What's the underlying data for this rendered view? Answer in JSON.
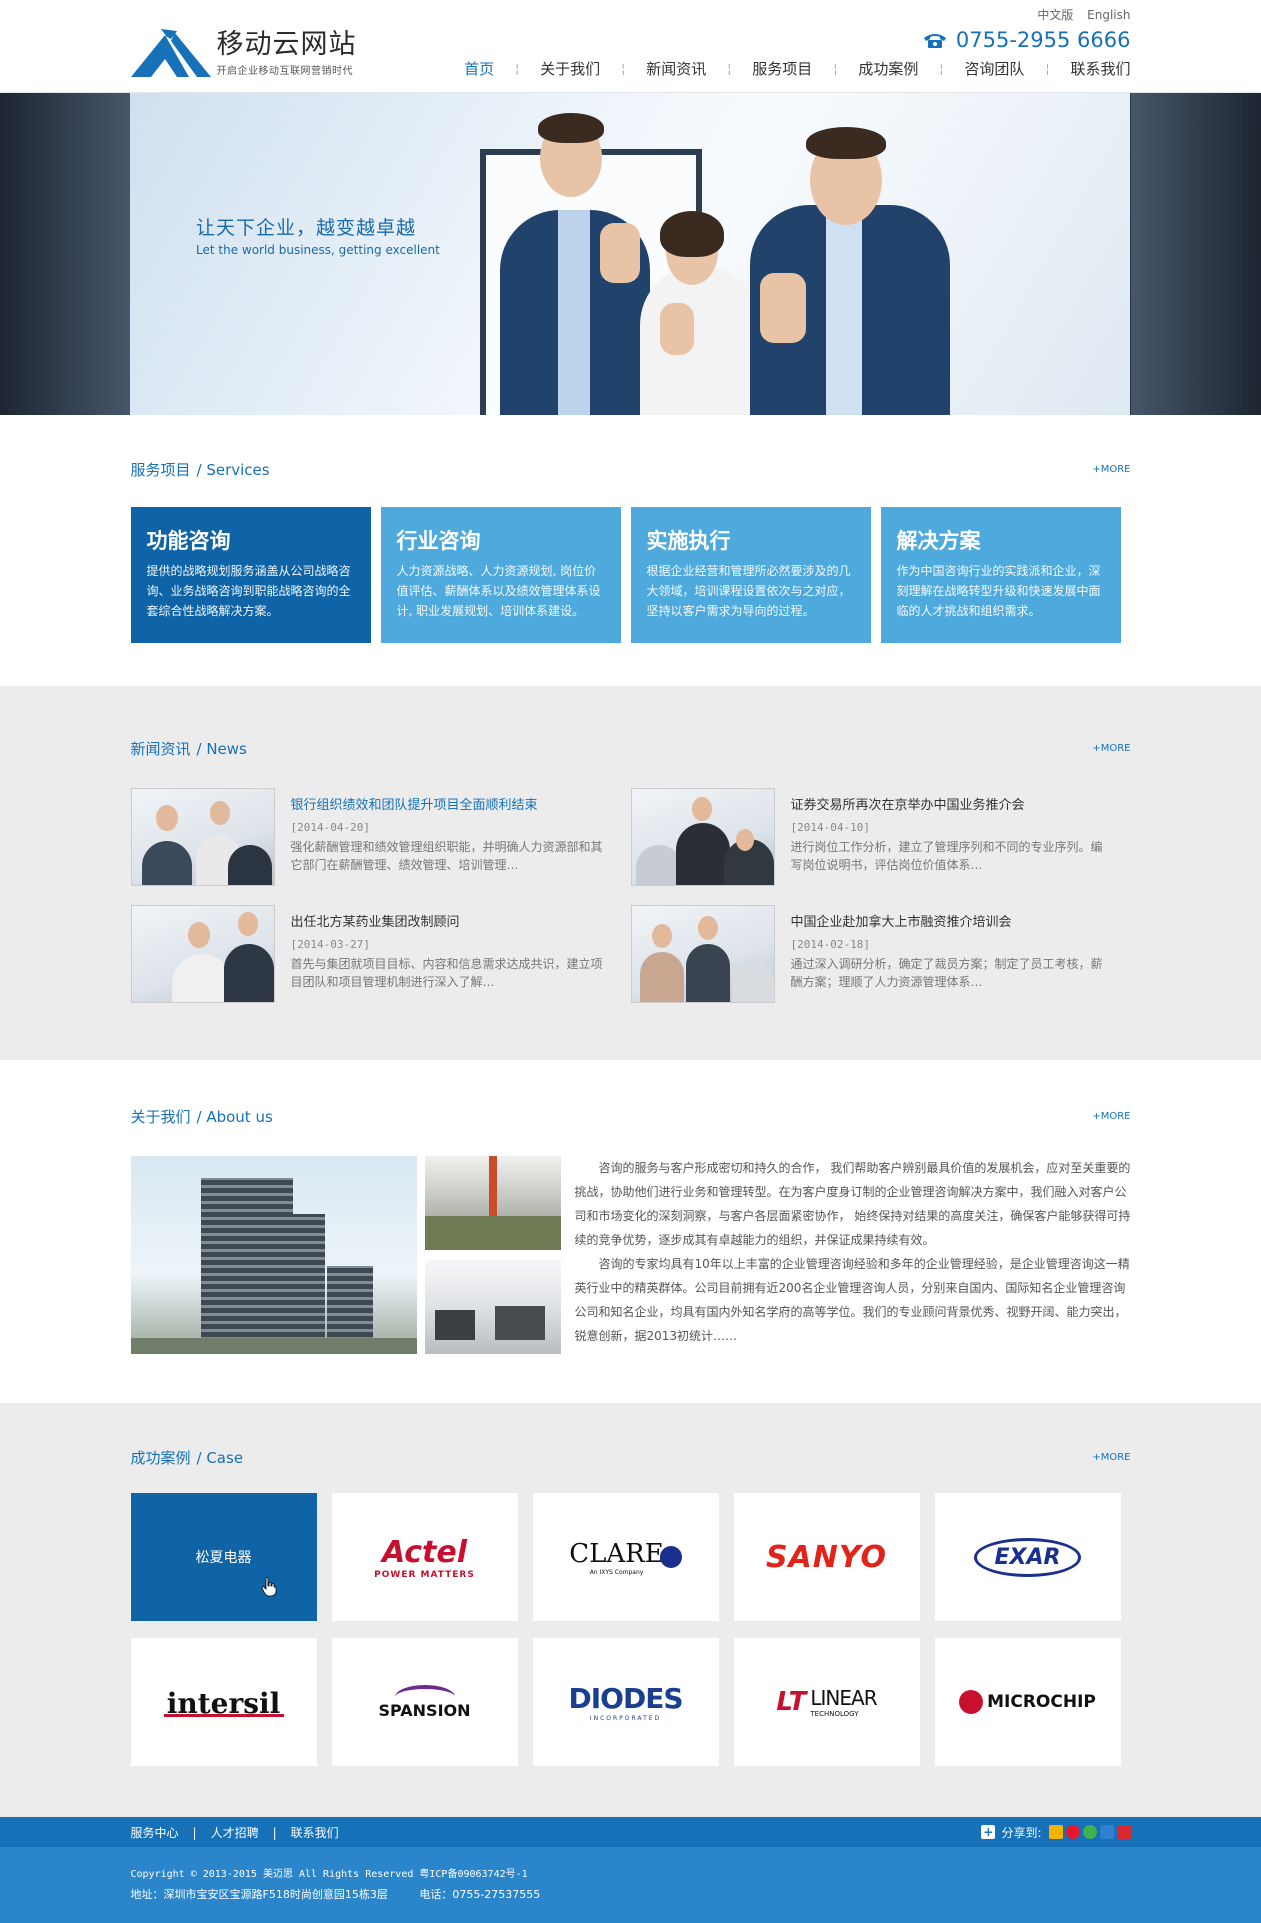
{
  "header": {
    "logo_title": "移动云网站",
    "logo_sub": "开启企业移动互联网营销时代",
    "lang": [
      "中文版",
      "English"
    ],
    "phone": "0755-2955 6666",
    "nav": [
      "首页",
      "关于我们",
      "新闻资讯",
      "服务项目",
      "成功案例",
      "咨询团队",
      "联系我们"
    ],
    "active_nav": 0
  },
  "banner": {
    "title_cn": "让天下企业，越变越卓越",
    "title_en": "Let the world business, getting excellent"
  },
  "services": {
    "title_cn": "服务项目",
    "title_en": "/ Services",
    "more": "+MORE",
    "items": [
      {
        "title": "功能咨询",
        "desc": "提供的战略规划服务涵盖从公司战略咨询、业务战略咨询到职能战略咨询的全套综合性战略解决方案。"
      },
      {
        "title": "行业咨询",
        "desc": "人力资源战略、人力资源规划, 岗位价值评估、薪酬体系以及绩效管理体系设计, 职业发展规划、培训体系建设。"
      },
      {
        "title": "实施执行",
        "desc": "根据企业经营和管理所必然要涉及的几大领域，培训课程设置依次与之对应，坚持以客户需求为导向的过程。"
      },
      {
        "title": "解决方案",
        "desc": "作为中国咨询行业的实践派和企业，深刻理解在战略转型升级和快速发展中面临的人才挑战和组织需求。"
      }
    ]
  },
  "news": {
    "title_cn": "新闻资讯",
    "title_en": "/ News",
    "more": "+MORE",
    "items": [
      {
        "title": "银行组织绩效和团队提升项目全面顺利结束",
        "date": "[2014-04-20]",
        "desc": "强化薪酬管理和绩效管理组织职能，并明确人力资源部和其它部门在薪酬管理、绩效管理、培训管理…"
      },
      {
        "title": "证券交易所再次在京举办中国业务推介会",
        "date": "[2014-04-10]",
        "desc": "进行岗位工作分析，建立了管理序列和不同的专业序列。编写岗位说明书，评估岗位价值体系…"
      },
      {
        "title": "出任北方某药业集团改制顾问",
        "date": "[2014-03-27]",
        "desc": "首先与集团就项目目标、内容和信息需求达成共识，建立项目团队和项目管理机制进行深入了解…"
      },
      {
        "title": "中国企业赴加拿大上市融资推介培训会",
        "date": "[2014-02-18]",
        "desc": "通过深入调研分析，确定了裁员方案；制定了员工考核，薪酬方案；理顺了人力资源管理体系…"
      }
    ]
  },
  "about": {
    "title_cn": "关于我们",
    "title_en": "/ About us",
    "more": "+MORE",
    "para1": "咨询的服务与客户形成密切和持久的合作， 我们帮助客户辨别最具价值的发展机会，应对至关重要的挑战，协助他们进行业务和管理转型。在为客户度身订制的企业管理咨询解决方案中，我们融入对客户公司和市场变化的深刻洞察，与客户各层面紧密协作， 始终保持对结果的高度关注，确保客户能够获得可持续的竞争优势，逐步成其有卓越能力的组织，并保证成果持续有效。",
    "para2": "咨询的专家均具有10年以上丰富的企业管理咨询经验和多年的企业管理经验，是企业管理咨询这一精英行业中的精英群体。公司目前拥有近200名企业管理咨询人员，分别来自国内、国际知名企业管理咨询公司和知名企业，均具有国内外知名学府的高等学位。我们的专业顾问背景优秀、视野开阔、能力突出，锐意创新，据2013初统计……"
  },
  "cases": {
    "title_cn": "成功案例",
    "title_en": "/ Case",
    "more": "+MORE",
    "active_label": "松夏电器",
    "logos": [
      {
        "text": "Actel",
        "sub": "POWER MATTERS",
        "color": "#c8102e"
      },
      {
        "text": "CLARE",
        "sub": "An IXYS Company",
        "color": "#111111"
      },
      {
        "text": "SANYO",
        "sub": "",
        "color": "#e2231a"
      },
      {
        "text": "EXAR",
        "sub": "",
        "color": "#1b2f8f"
      },
      {
        "text": "intersil",
        "sub": "",
        "color": "#111111"
      },
      {
        "text": "SPANSION",
        "sub": "",
        "color": "#111111"
      },
      {
        "text": "DIODES",
        "sub": "INCORPORATED",
        "color": "#1b3f8f"
      },
      {
        "text": "LINEAR",
        "sub": "TECHNOLOGY",
        "color": "#111111"
      },
      {
        "text": "MICROCHIP",
        "sub": "",
        "color": "#111111"
      }
    ]
  },
  "footer": {
    "links": [
      "服务中心",
      "人才招聘",
      "联系我们"
    ],
    "share_label": "分享到:",
    "copyright": "Copyright © 2013-2015 美迈思 All Rights Reserved 粤ICP备09063742号-1",
    "address": "地址：深圳市宝安区宝源路F518时尚创意园15栋3层",
    "tel": "电话：0755-27537555"
  },
  "colors": {
    "brand": "#1671b8",
    "service_dark": "#0f64a8",
    "service_light": "#4ea9dc",
    "section_gray": "#ececec"
  }
}
